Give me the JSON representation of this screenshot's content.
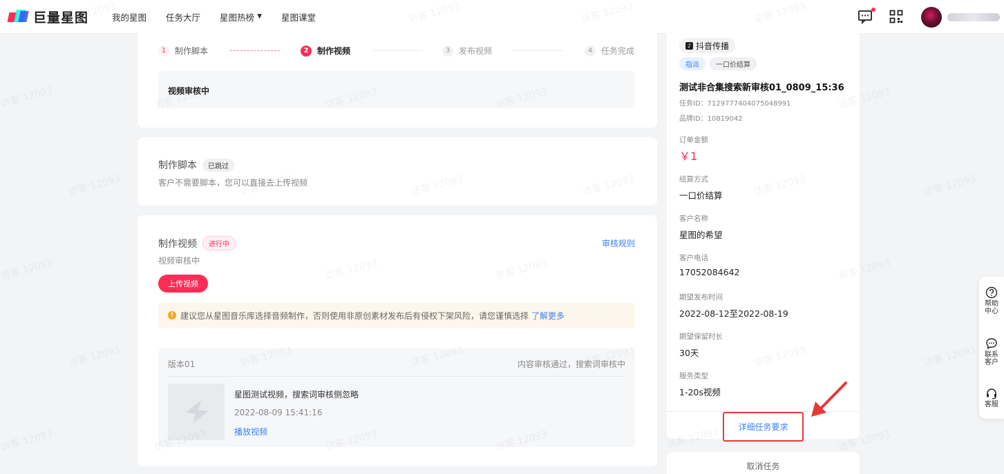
{
  "header": {
    "brand": "巨量星图",
    "nav": [
      {
        "label": "我的星图"
      },
      {
        "label": "任务大厅"
      },
      {
        "label": "星图热榜"
      },
      {
        "label": "星图课堂"
      }
    ]
  },
  "steps": [
    {
      "num": "1",
      "label": "制作脚本",
      "state": "done"
    },
    {
      "num": "2",
      "label": "制作视频",
      "state": "active"
    },
    {
      "num": "3",
      "label": "发布视频",
      "state": "todo"
    },
    {
      "num": "4",
      "label": "任务完成",
      "state": "todo"
    }
  ],
  "review_status": "视频审核中",
  "script_section": {
    "title": "制作脚本",
    "tag": "已跳过",
    "desc": "客户不需要脚本，您可以直接去上传视频"
  },
  "video_section": {
    "title": "制作视频",
    "tag": "进行中",
    "rule_link": "审核规则",
    "status": "视频审核中",
    "upload_button": "上传视频",
    "notice_text": "建议您从星图音乐库选择音频制作，否则使用非原创素材发布后有侵权下架风险，请您谨慎选择",
    "notice_link": "了解更多",
    "version": {
      "name": "版本01",
      "status": "内容审核通过，搜索词审核中",
      "video_title": "星图测试视频，搜索词审核侧忽略",
      "video_time": "2022-08-09 15:41:16",
      "play_link": "播放视频"
    }
  },
  "task_panel": {
    "platform": "抖音传播",
    "chips": [
      "指派",
      "一口价结算"
    ],
    "title": "测试非合集搜索新审核01_0809_15:36",
    "task_id": "任务ID：7129777404075048991",
    "brand_id": "品牌ID：10819042",
    "fields": [
      {
        "label": "订单金额",
        "value": "￥1"
      },
      {
        "label": "结算方式",
        "value": "一口价结算"
      },
      {
        "label": "客户名称",
        "value": "星图的希望"
      },
      {
        "label": "客户电话",
        "value": "17052084642"
      },
      {
        "label": "期望发布时间",
        "value": "2022-08-12至2022-08-19"
      },
      {
        "label": "期望保留时长",
        "value": "30天"
      },
      {
        "label": "服务类型",
        "value": "1-20s视频"
      }
    ],
    "detail_button": "详细任务要求",
    "cancel_button": "取消任务"
  },
  "float_bar": [
    {
      "label": "帮助中心",
      "icon": "question-circle-icon"
    },
    {
      "label": "联系客户",
      "icon": "chat-bubble-icon"
    },
    {
      "label": "客服",
      "icon": "headset-icon"
    }
  ],
  "watermark": "访客 12093",
  "colors": {
    "accent": "#fe2c55",
    "link": "#3b82f6",
    "highlight_box": "#e53935"
  }
}
